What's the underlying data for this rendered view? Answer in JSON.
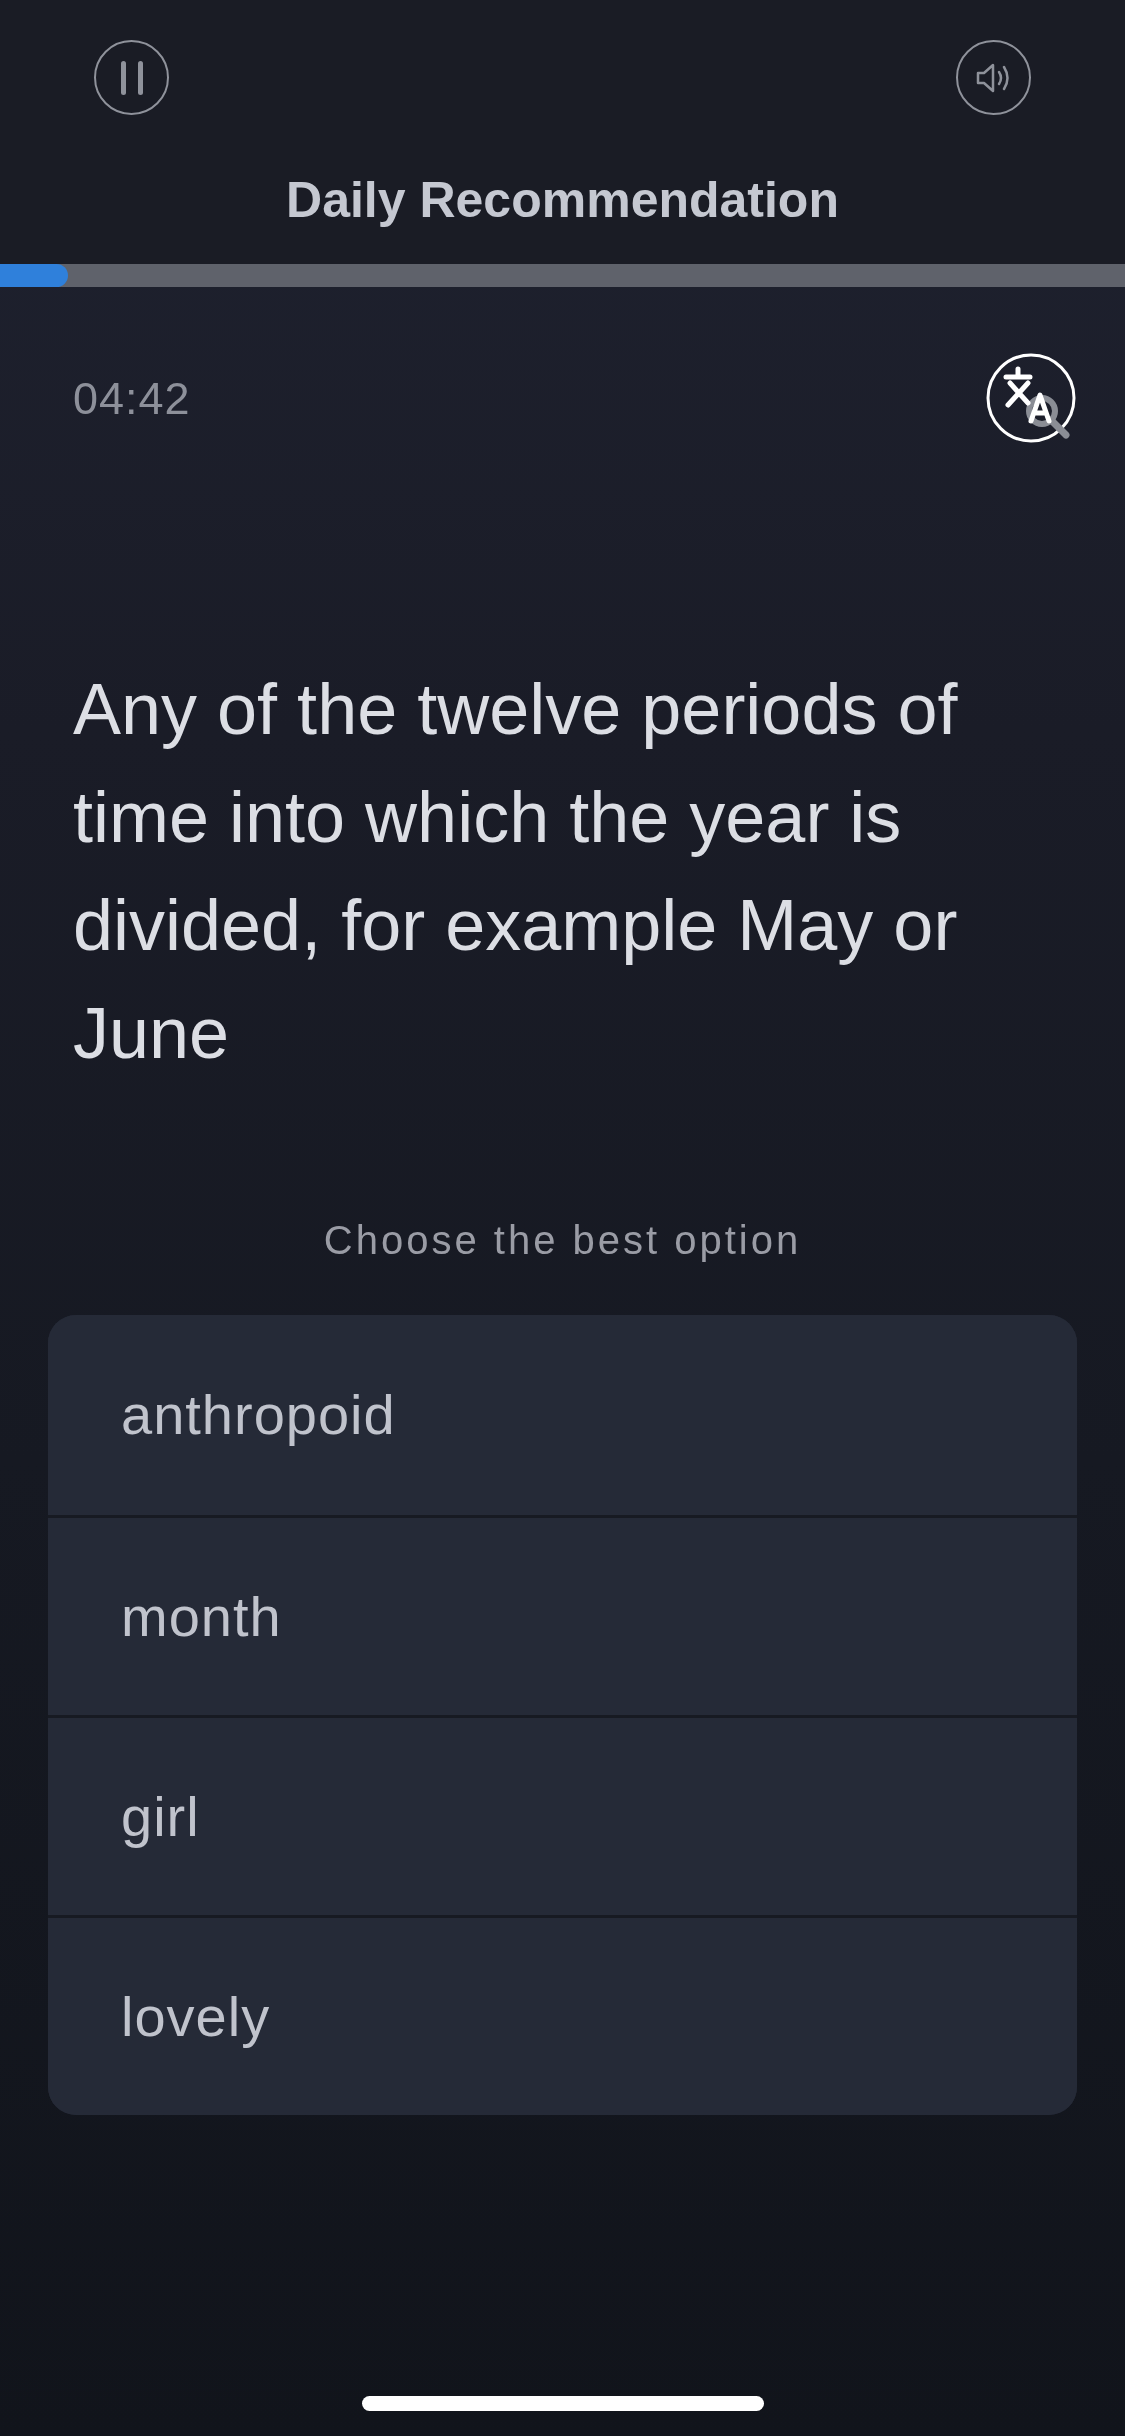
{
  "header": {
    "title": "Daily Recommendation"
  },
  "progress": {
    "level": 0.06
  },
  "timer": "04:42",
  "question": "Any of the twelve periods of time into which the year is divided, for example May or June",
  "prompt": "Choose the best option",
  "options": [
    "anthropoid",
    "month",
    "girl",
    "lovely"
  ]
}
